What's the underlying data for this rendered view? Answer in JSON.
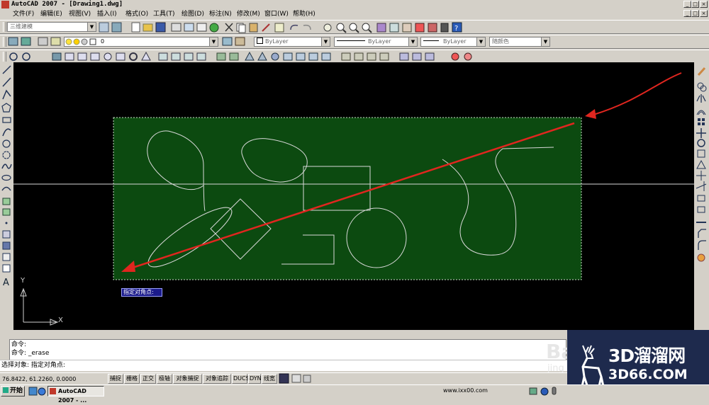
{
  "window": {
    "title": "AutoCAD 2007 - [Drawing1.dwg]",
    "caption_buttons": [
      "_",
      "□",
      "×"
    ],
    "doc_buttons": [
      "_",
      "□",
      "×"
    ]
  },
  "menu": [
    "文件(F)",
    "编辑(E)",
    "视图(V)",
    "插入(I)",
    "格式(O)",
    "工具(T)",
    "绘图(D)",
    "标注(N)",
    "修改(M)",
    "窗口(W)",
    "帮助(H)"
  ],
  "toolbar": {
    "workspace": "三维建模",
    "layer": "0",
    "color": "ByLayer",
    "linetype": "ByLayer",
    "lineweight": "ByLayer",
    "plotstyle": "随颜色"
  },
  "drawing": {
    "tooltip": "指定对角点:",
    "ucs_y": "Y",
    "ucs_x": "X",
    "colors": {
      "background": "#000000",
      "selection": "#0c4a10",
      "geometry": "#d8d8d8",
      "arrow": "#e0261f"
    }
  },
  "command": {
    "lines": [
      "命令:",
      "命令: _erase",
      "选择对象: 指定对角点:"
    ]
  },
  "status": {
    "coords": "76.8422,  61.2260, 0.0000",
    "buttons": [
      "捕捉",
      "栅格",
      "正交",
      "极轴",
      "对象捕捉",
      "对象追踪",
      "DUCS",
      "DYN",
      "线宽"
    ]
  },
  "taskbar": {
    "start": "开始",
    "task": "AutoCAD 2007 - ...",
    "url": "www.ixx00.com"
  },
  "watermark": {
    "line1": "3D溜溜网",
    "line2": "3D66.COM",
    "ghost1": "Ba",
    "ghost2": "jing"
  }
}
